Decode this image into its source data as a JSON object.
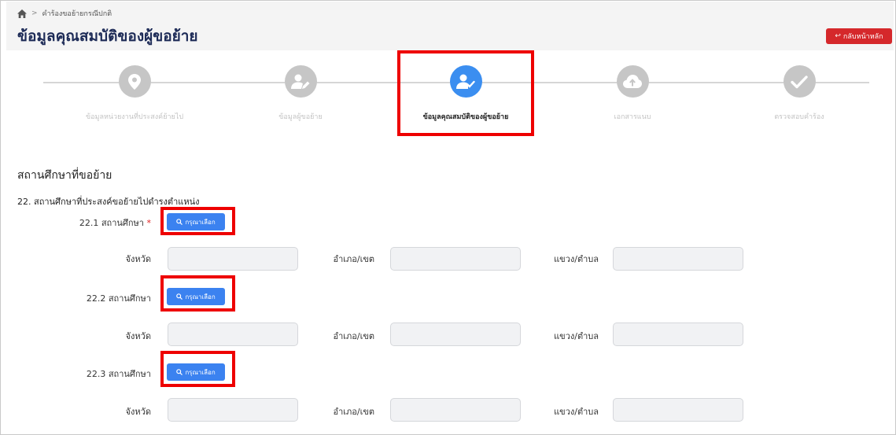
{
  "breadcrumb": {
    "current": "คำร้องขอย้ายกรณีปกติ"
  },
  "page": {
    "title": "ข้อมูลคุณสมบัติของผู้ขอย้าย"
  },
  "actions": {
    "back_label": "กลับหน้าหลัก"
  },
  "steps": [
    {
      "label": "ข้อมูลหน่วยงานที่ประสงค์ย้ายไป",
      "icon": "map-pin-icon",
      "active": false
    },
    {
      "label": "ข้อมูลผู้ขอย้าย",
      "icon": "user-edit-icon",
      "active": false
    },
    {
      "label": "ข้อมูลคุณสมบัติของผู้ขอย้าย",
      "icon": "user-check-icon",
      "active": true
    },
    {
      "label": "เอกสารแนบ",
      "icon": "cloud-upload-icon",
      "active": false
    },
    {
      "label": "ตรวจสอบคำร้อง",
      "icon": "check-icon",
      "active": false
    }
  ],
  "section": {
    "title": "สถานศึกษาที่ขอย้าย",
    "question": "22. สถานศึกษาที่ประสงค์ขอย้ายไปดำรงตำแหน่ง"
  },
  "schools": [
    {
      "label": "22.1 สถานศึกษา",
      "required": "*",
      "button": "กรุณาเลือก",
      "province": "จังหวัด",
      "district": "อำเภอ/เขต",
      "subdistrict": "แขวง/ตำบล"
    },
    {
      "label": "22.2 สถานศึกษา",
      "required": "",
      "button": "กรุณาเลือก",
      "province": "จังหวัด",
      "district": "อำเภอ/เขต",
      "subdistrict": "แขวง/ตำบล"
    },
    {
      "label": "22.3 สถานศึกษา",
      "required": "",
      "button": "กรุณาเลือก",
      "province": "จังหวัด",
      "district": "อำเภอ/เขต",
      "subdistrict": "แขวง/ตำบล"
    }
  ],
  "colors": {
    "accent": "#3b8ef0",
    "highlight": "#ee0000",
    "back_button": "#d5282b",
    "title": "#1d2b57"
  }
}
